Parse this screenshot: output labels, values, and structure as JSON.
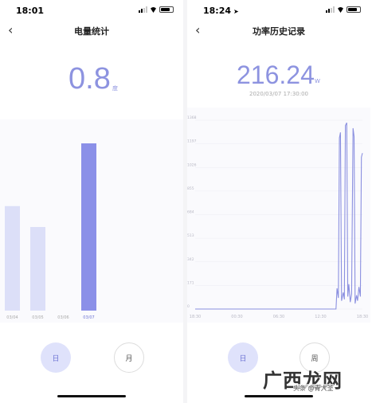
{
  "left_screen": {
    "status": {
      "time": "18:01"
    },
    "nav": {
      "back_icon": "chevron-left",
      "title": "电量统计"
    },
    "reading": {
      "value": "0.8",
      "unit": "度"
    },
    "chart_data": {
      "type": "bar",
      "categories": [
        "03/04",
        "03/05",
        "03/06",
        "03/07"
      ],
      "values": [
        1.0,
        0.8,
        0,
        1.6
      ],
      "selected_category": "03/07",
      "colors": {
        "normal": "#dcdff8",
        "selected": "#8b90e8"
      }
    },
    "period_tabs": [
      {
        "label": "日",
        "active": true
      },
      {
        "label": "月",
        "active": false
      }
    ]
  },
  "right_screen": {
    "status": {
      "time": "18:24"
    },
    "nav": {
      "back_icon": "chevron-left",
      "title": "功率历史记录"
    },
    "reading": {
      "value": "216.24",
      "unit": "W",
      "timestamp": "2020/03/07 17:30:00"
    },
    "chart_data": {
      "type": "line",
      "yticks": [
        "0",
        "171",
        "342",
        "513",
        "684",
        "855",
        "1026",
        "1197",
        "1368"
      ],
      "xticks": [
        "18:30",
        "00:30",
        "06:30",
        "12:30",
        "18:30"
      ],
      "ylim": [
        0,
        1368
      ],
      "series": [
        {
          "color": "#8b90e0",
          "points": [
            [
              0,
              0
            ],
            [
              20.2,
              0
            ],
            [
              20.35,
              150
            ],
            [
              20.55,
              80
            ],
            [
              20.7,
              1240
            ],
            [
              20.85,
              1280
            ],
            [
              21.0,
              60
            ],
            [
              21.25,
              120
            ],
            [
              21.4,
              70
            ],
            [
              21.55,
              1330
            ],
            [
              21.75,
              1350
            ],
            [
              21.9,
              90
            ],
            [
              22.05,
              180
            ],
            [
              22.25,
              50
            ],
            [
              22.45,
              110
            ],
            [
              22.65,
              1310
            ],
            [
              22.8,
              1250
            ],
            [
              22.95,
              40
            ],
            [
              23.15,
              100
            ],
            [
              23.3,
              60
            ],
            [
              23.5,
              160
            ],
            [
              23.7,
              90
            ],
            [
              23.85,
              1100
            ],
            [
              24,
              1130
            ]
          ]
        }
      ]
    },
    "period_tabs": [
      {
        "label": "日",
        "active": true
      },
      {
        "label": "周",
        "active": false
      }
    ]
  },
  "watermark": {
    "main": "广西龙网",
    "sub": "头条 @青大圣"
  },
  "colors": {
    "accent": "#8d93e0",
    "accent_light": "#dfe2fb"
  }
}
